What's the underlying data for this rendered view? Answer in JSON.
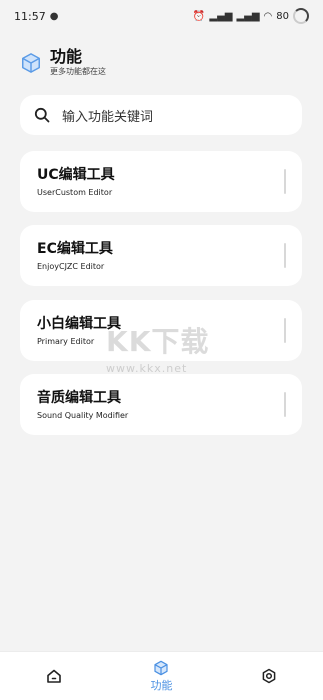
{
  "status_bar": {
    "time": "11:57",
    "battery": "80"
  },
  "header": {
    "title": "功能",
    "subtitle": "更多功能都在这"
  },
  "search": {
    "placeholder": "输入功能关键词"
  },
  "cards": [
    {
      "title": "UC编辑工具",
      "subtitle": "UserCustom Editor"
    },
    {
      "title": "EC编辑工具",
      "subtitle": "EnjoyCJZC Editor"
    },
    {
      "title": "小白编辑工具",
      "subtitle": "Primary Editor"
    },
    {
      "title": "音质编辑工具",
      "subtitle": "Sound Quality Modifier"
    }
  ],
  "watermark": {
    "main": "KK下载",
    "url": "www.kkx.net"
  },
  "bottom_nav": {
    "home_icon": "home-icon",
    "features_icon": "cube-icon",
    "features_label": "功能",
    "settings_icon": "gear-icon",
    "active_color": "#4a90e2"
  }
}
